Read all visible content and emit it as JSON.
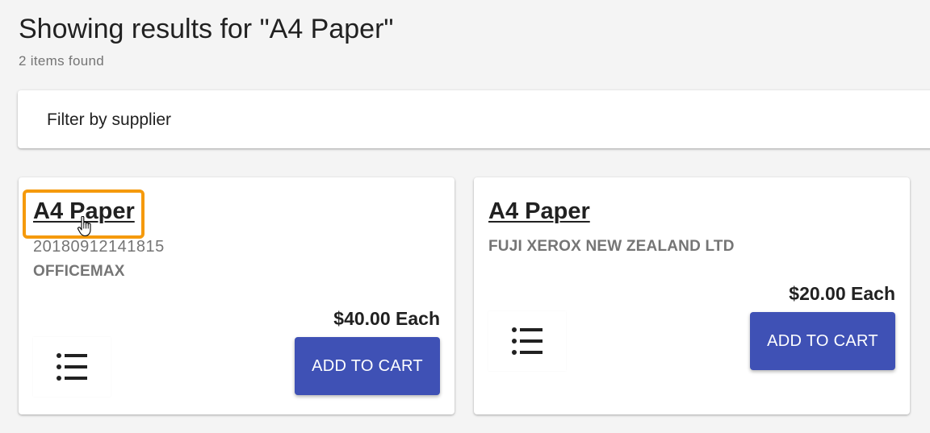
{
  "header": {
    "title": "Showing results for \"A4 Paper\"",
    "count": "2 items found"
  },
  "filter": {
    "label": "Filter by supplier"
  },
  "products": [
    {
      "name": "A4 Paper",
      "code": "20180912141815",
      "supplier": "OFFICEMAX",
      "price": "$40.00 Each",
      "button": "ADD TO CART"
    },
    {
      "name": "A4 Paper",
      "code": "",
      "supplier": "FUJI XEROX NEW ZEALAND LTD",
      "price": "$20.00 Each",
      "button": "ADD TO CART"
    }
  ],
  "icons": {
    "list": "list-icon",
    "cursor": "hand-pointer-icon"
  },
  "colors": {
    "accent": "#3f51b5",
    "highlight": "#f59a0c"
  }
}
